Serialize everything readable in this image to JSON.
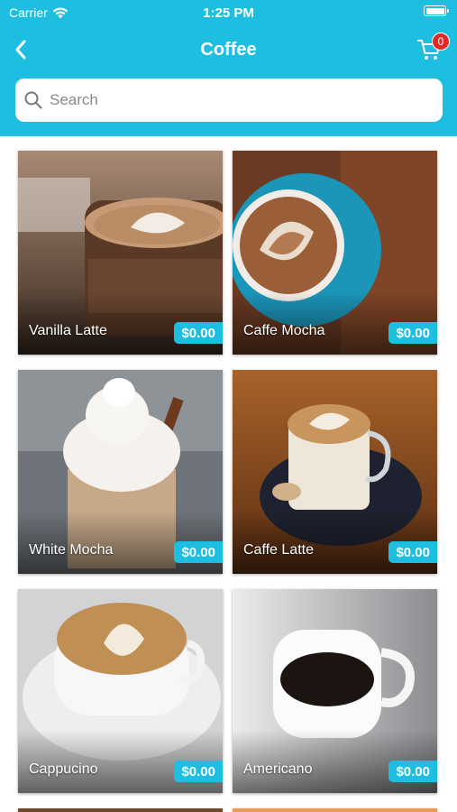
{
  "status_bar": {
    "carrier": "Carrier",
    "time": "1:25 PM"
  },
  "nav": {
    "title": "Coffee",
    "cart_count": "0",
    "back_icon": "chevron-left-icon",
    "cart_icon": "cart-icon"
  },
  "search": {
    "placeholder": "Search",
    "value": ""
  },
  "colors": {
    "accent": "#1ebee0",
    "badge": "#e02a2a"
  },
  "products": [
    {
      "name": "Vanilla Latte",
      "price": "$0.00"
    },
    {
      "name": "Caffe Mocha",
      "price": "$0.00"
    },
    {
      "name": "White Mocha",
      "price": "$0.00"
    },
    {
      "name": "Caffe Latte",
      "price": "$0.00"
    },
    {
      "name": "Cappucino",
      "price": "$0.00"
    },
    {
      "name": "Americano",
      "price": "$0.00"
    }
  ]
}
